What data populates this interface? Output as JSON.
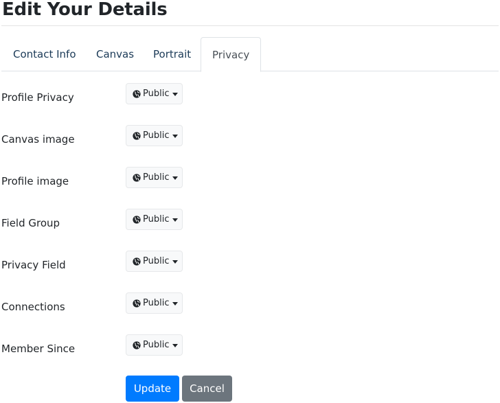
{
  "page": {
    "title": "Edit Your Details"
  },
  "tabs": [
    {
      "label": "Contact Info",
      "active": false
    },
    {
      "label": "Canvas",
      "active": false
    },
    {
      "label": "Portrait",
      "active": false
    },
    {
      "label": "Privacy",
      "active": true
    }
  ],
  "privacy_fields": [
    {
      "label": "Profile Privacy",
      "value": "Public",
      "icon": "globe-icon"
    },
    {
      "label": "Canvas image",
      "value": "Public",
      "icon": "globe-icon"
    },
    {
      "label": "Profile image",
      "value": "Public",
      "icon": "globe-icon"
    },
    {
      "label": "Field Group",
      "value": "Public",
      "icon": "globe-icon"
    },
    {
      "label": "Privacy Field",
      "value": "Public",
      "icon": "globe-icon"
    },
    {
      "label": "Connections",
      "value": "Public",
      "icon": "globe-icon"
    },
    {
      "label": "Member Since",
      "value": "Public",
      "icon": "globe-icon"
    }
  ],
  "actions": {
    "update_label": "Update",
    "cancel_label": "Cancel"
  },
  "colors": {
    "primary": "#007bff",
    "secondary": "#6c757d",
    "dropdown_bg": "#f8f9fa"
  }
}
